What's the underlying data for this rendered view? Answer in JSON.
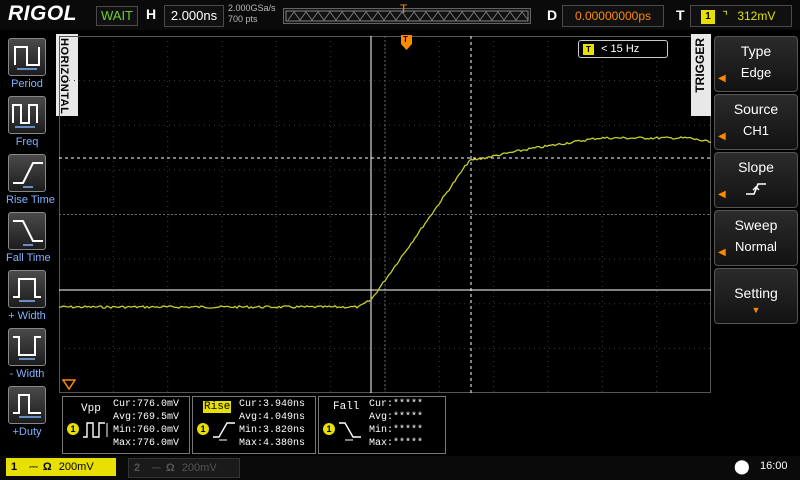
{
  "header": {
    "brand": "RIGOL",
    "run_status": "WAIT",
    "h_label": "H",
    "timebase": "2.000ns",
    "sample_rate": "2.000GSa/s",
    "memory_depth": "700 pts",
    "memory_trigger_marker": "T",
    "d_label": "D",
    "delay": "0.00000000ps",
    "t_label": "T",
    "trigger_source_badge": "1",
    "trigger_level": "312mV"
  },
  "left_menu": {
    "items": [
      {
        "label": "Period",
        "icon": "period-icon"
      },
      {
        "label": "Freq",
        "icon": "freq-icon"
      },
      {
        "label": "Rise Time",
        "icon": "rise-time-icon"
      },
      {
        "label": "Fall Time",
        "icon": "fall-time-icon"
      },
      {
        "label": "+ Width",
        "icon": "pos-width-icon"
      },
      {
        "label": "- Width",
        "icon": "neg-width-icon"
      },
      {
        "label": "+Duty",
        "icon": "duty-icon"
      }
    ],
    "tab": "HORIZONTAL"
  },
  "screen": {
    "freq_badge": "T",
    "freq_readout": "< 15 Hz",
    "trigger_marker": "T"
  },
  "right_menu": {
    "tab": "TRIGGER",
    "items": [
      {
        "title": "Type",
        "value": "Edge"
      },
      {
        "title": "Source",
        "value": "CH1"
      },
      {
        "title": "Slope",
        "value": ""
      },
      {
        "title": "Sweep",
        "value": "Normal"
      },
      {
        "title": "Setting",
        "value": ""
      }
    ]
  },
  "measurements": {
    "vpp": {
      "name": "Vpp",
      "channel": "1",
      "cur": "Cur:776.0mV",
      "avg": "Avg:769.5mV",
      "min": "Min:760.0mV",
      "max": "Max:776.0mV"
    },
    "rise": {
      "name": "Rise",
      "channel": "1",
      "cur": "Cur:3.940ns",
      "avg": "Avg:4.049ns",
      "min": "Min:3.820ns",
      "max": "Max:4.380ns"
    },
    "fall": {
      "name": "Fall",
      "channel": "1",
      "cur": "Cur:*****",
      "avg": "Avg:*****",
      "min": "Min:*****",
      "max": "Max:*****"
    }
  },
  "footer": {
    "ch1_number": "1",
    "ch1_scale": "200mV",
    "ch2_number": "2",
    "ch2_scale": "200mV",
    "time": "16:00"
  },
  "colors": {
    "trace": "#c8cf2a",
    "accent_orange": "#ff8a00",
    "ch1_yellow": "#e8e000"
  }
}
